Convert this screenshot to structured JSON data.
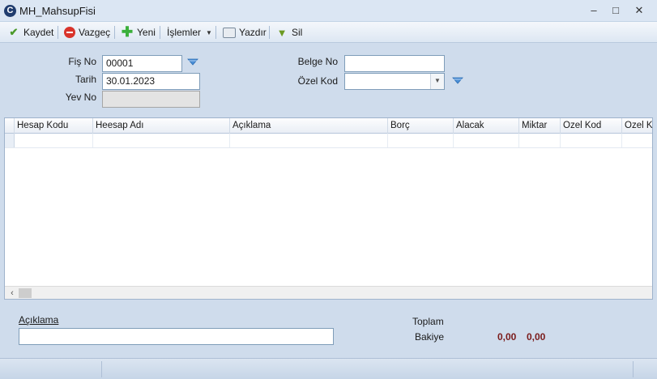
{
  "window": {
    "title": "MH_MahsupFisi",
    "app_icon_glyph": "C",
    "minimize_glyph": "–",
    "maximize_glyph": "□",
    "close_glyph": "✕"
  },
  "toolbar": {
    "save_label": "Kaydet",
    "cancel_label": "Vazgeç",
    "new_label": "Yeni",
    "operations_label": "İşlemler",
    "print_label": "Yazdır",
    "delete_label": "Sil"
  },
  "form": {
    "fis_no_label": "Fiş No",
    "fis_no_value": "00001",
    "tarih_label": "Tarih",
    "tarih_value": "30.01.2023",
    "yev_no_label": "Yev No",
    "yev_no_value": "",
    "belge_no_label": "Belge No",
    "belge_no_value": "",
    "ozel_kod_label": "Özel Kod",
    "ozel_kod_value": ""
  },
  "grid": {
    "columns": [
      "Hesap Kodu",
      "Heesap Adı",
      "Açıklama",
      "Borç",
      "Alacak",
      "Miktar",
      "Ozel Kod",
      "Ozel Kod"
    ]
  },
  "footer": {
    "aciklama_label": "Açıklama",
    "aciklama_value": "",
    "toplam_label": "Toplam",
    "bakiye_label": "Bakiye",
    "bakiye_val1": "0,00",
    "bakiye_val2": "0,00"
  },
  "colors": {
    "accent": "#1f3c6e",
    "window_bg": "#cfdcec",
    "total_text": "#7a1a1a"
  }
}
